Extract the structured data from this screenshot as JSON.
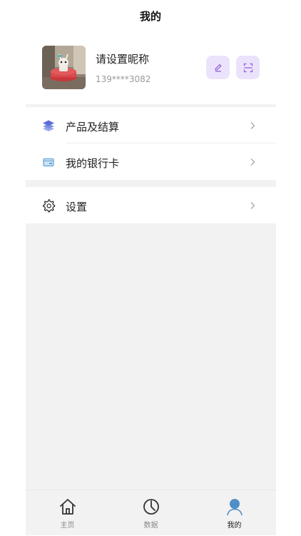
{
  "header": {
    "title": "我的"
  },
  "profile": {
    "nickname": "请设置昵称",
    "phone": "139****3082"
  },
  "menu": {
    "group1": [
      {
        "label": "产品及结算",
        "icon": "layers-icon"
      },
      {
        "label": "我的银行卡",
        "icon": "bank-card-icon"
      }
    ],
    "group2": [
      {
        "label": "设置",
        "icon": "gear-icon"
      }
    ]
  },
  "tabbar": {
    "tabs": [
      {
        "label": "主页",
        "icon": "home-icon"
      },
      {
        "label": "数据",
        "icon": "chart-icon"
      },
      {
        "label": "我的",
        "icon": "user-icon",
        "active": true
      }
    ]
  },
  "colors": {
    "accent_bg": "#ebe3fb",
    "accent_icon": "#8e5ad9",
    "active_tab": "#4e8fc9",
    "page_bg": "#f2f2f2"
  }
}
